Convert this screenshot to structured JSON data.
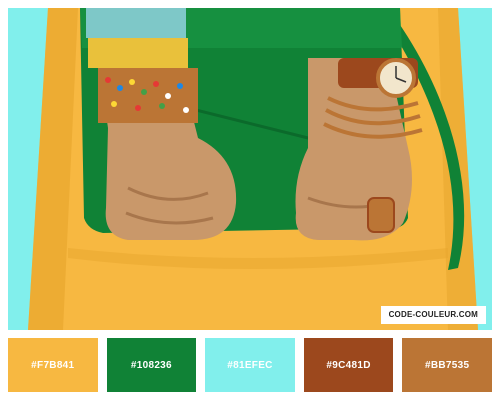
{
  "watermark": "CODE-COULEUR.COM",
  "photo": {
    "colors": {
      "background": "#81EFEC",
      "skirt": "#F7B841",
      "skirt_shadow": "#E8A62E",
      "clutch": "#108236",
      "clutch_highlight": "#1A9A47",
      "skin": "#C9986A",
      "skin_shadow": "#A8764C",
      "bracelet_gold": "#BB7535",
      "bracelet_brown": "#9C481D"
    }
  },
  "palette": [
    {
      "hex": "#F7B841",
      "label": "#F7B841"
    },
    {
      "hex": "#108236",
      "label": "#108236"
    },
    {
      "hex": "#81EFEC",
      "label": "#81EFEC"
    },
    {
      "hex": "#9C481D",
      "label": "#9C481D"
    },
    {
      "hex": "#BB7535",
      "label": "#BB7535"
    }
  ]
}
